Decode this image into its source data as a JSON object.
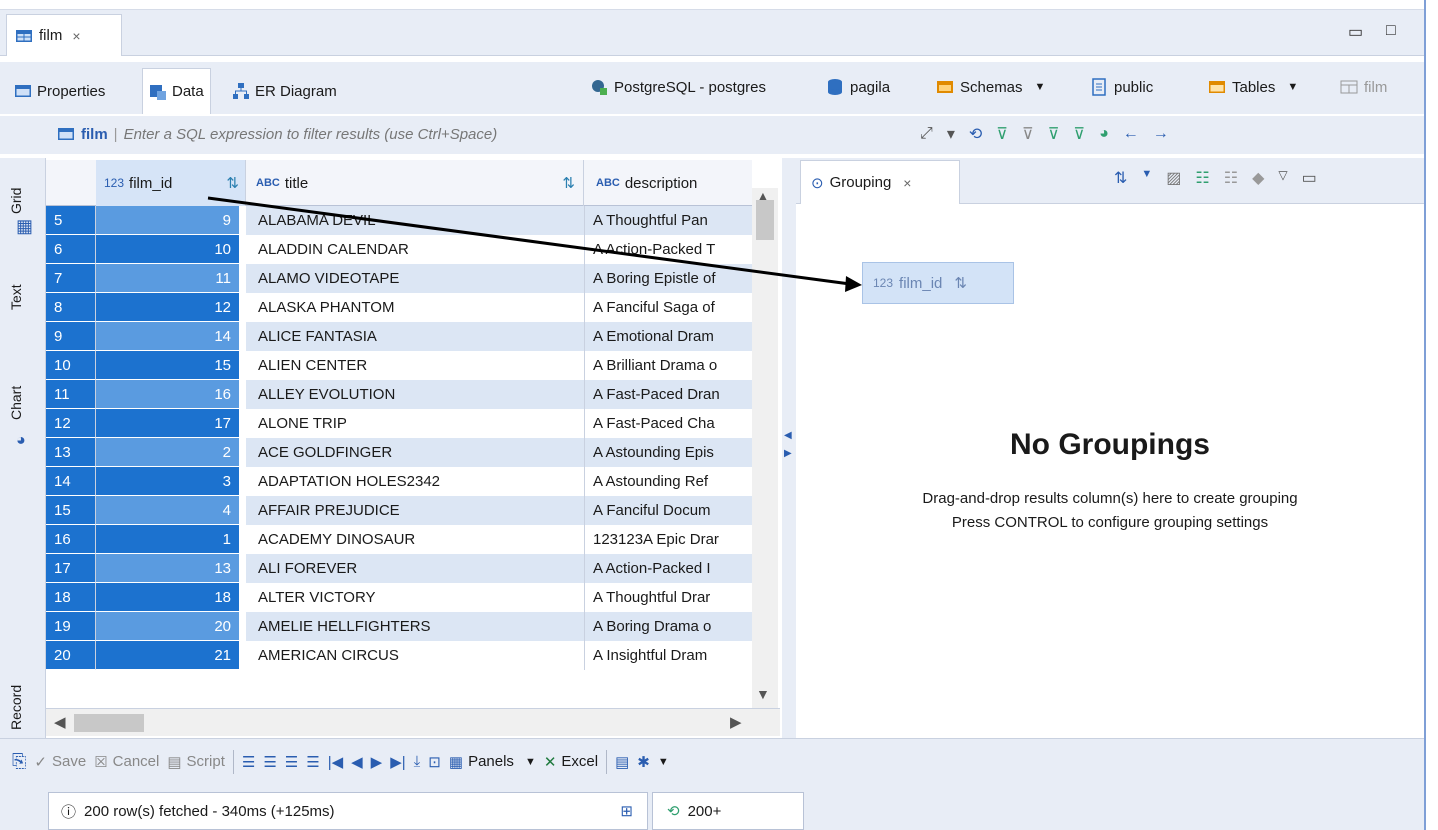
{
  "editor_tab": {
    "label": "film",
    "close": "×"
  },
  "subtabs": {
    "properties": "Properties",
    "data": "Data",
    "er_diagram": "ER Diagram"
  },
  "breadcrumb": {
    "connection": "PostgreSQL - postgres",
    "database": "pagila",
    "schemas": "Schemas",
    "schema": "public",
    "tables": "Tables",
    "table": "film"
  },
  "filter": {
    "entity": "film",
    "placeholder": "Enter a SQL expression to filter results (use Ctrl+Space)"
  },
  "side_tabs": {
    "grid": "Grid",
    "text": "Text",
    "chart": "Chart",
    "record": "Record"
  },
  "columns": {
    "film_id_type": "123",
    "film_id": "film_id",
    "title_type": "ABC",
    "title": "title",
    "description_type": "ABC",
    "description": "description"
  },
  "rows": [
    {
      "n": "5",
      "id": "9",
      "title": "ALABAMA DEVIL",
      "desc": "A Thoughtful Pan"
    },
    {
      "n": "6",
      "id": "10",
      "title": "ALADDIN CALENDAR",
      "desc": "A Action-Packed T"
    },
    {
      "n": "7",
      "id": "11",
      "title": "ALAMO VIDEOTAPE",
      "desc": "A Boring Epistle of"
    },
    {
      "n": "8",
      "id": "12",
      "title": "ALASKA PHANTOM",
      "desc": "A Fanciful Saga of"
    },
    {
      "n": "9",
      "id": "14",
      "title": "ALICE FANTASIA",
      "desc": "A Emotional Dram"
    },
    {
      "n": "10",
      "id": "15",
      "title": "ALIEN CENTER",
      "desc": "A Brilliant Drama o"
    },
    {
      "n": "11",
      "id": "16",
      "title": "ALLEY EVOLUTION",
      "desc": "A Fast-Paced Dran"
    },
    {
      "n": "12",
      "id": "17",
      "title": "ALONE TRIP",
      "desc": "A Fast-Paced Cha"
    },
    {
      "n": "13",
      "id": "2",
      "title": "ACE GOLDFINGER",
      "desc": "A Astounding Epis"
    },
    {
      "n": "14",
      "id": "3",
      "title": "ADAPTATION HOLES2342",
      "desc": "A Astounding Ref"
    },
    {
      "n": "15",
      "id": "4",
      "title": "AFFAIR PREJUDICE",
      "desc": "A Fanciful Docum"
    },
    {
      "n": "16",
      "id": "1",
      "title": "ACADEMY DINOSAUR",
      "desc": "123123A Epic Drar"
    },
    {
      "n": "17",
      "id": "13",
      "title": "ALI FOREVER",
      "desc": "A Action-Packed I"
    },
    {
      "n": "18",
      "id": "18",
      "title": "ALTER VICTORY",
      "desc": "A Thoughtful Drar"
    },
    {
      "n": "19",
      "id": "20",
      "title": "AMELIE HELLFIGHTERS",
      "desc": "A Boring Drama o"
    },
    {
      "n": "20",
      "id": "21",
      "title": "AMERICAN CIRCUS",
      "desc": "A Insightful Dram"
    }
  ],
  "grouping": {
    "tab": "Grouping",
    "chip_type": "123",
    "chip_label": "film_id",
    "title": "No Groupings",
    "hint1": "Drag-and-drop results column(s) here to create grouping",
    "hint2": "Press CONTROL to configure grouping settings"
  },
  "bottom": {
    "save": "Save",
    "cancel": "Cancel",
    "script": "Script",
    "panels": "Panels",
    "excel": "Excel"
  },
  "status": {
    "fetched": "200 row(s) fetched - 340ms (+125ms)",
    "count": "200+"
  },
  "colors": {
    "accent": "#1c72cf",
    "toolbar_bg": "#e8edf6",
    "row_alt": "#dce6f4"
  }
}
